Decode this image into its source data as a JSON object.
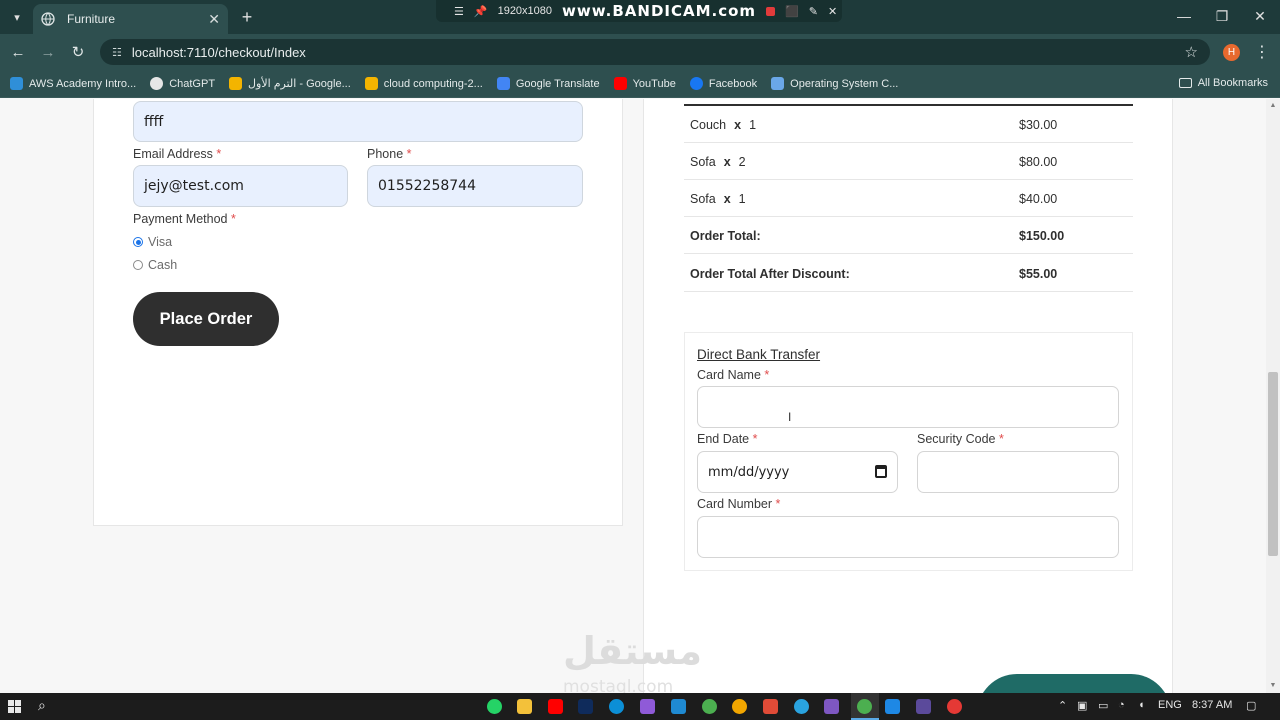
{
  "browser": {
    "tab_title": "Furniture",
    "url": "localhost:7110/checkout/Index",
    "recorder_resolution": "1920x1080",
    "recorder_brand": "www.BANDICAM.com",
    "bookmarks": [
      {
        "label": "AWS Academy Intro...",
        "color": "#2f8fd8"
      },
      {
        "label": "ChatGPT",
        "color": "#e6e6e6"
      },
      {
        "label": "الترم الأول - Google...",
        "color": "#f4b400"
      },
      {
        "label": "cloud computing-2...",
        "color": "#f4b400"
      },
      {
        "label": "Google Translate",
        "color": "#4285f4"
      },
      {
        "label": "YouTube",
        "color": "#ff0000"
      },
      {
        "label": "Facebook",
        "color": "#1877f2"
      },
      {
        "label": "Operating System C...",
        "color": "#6aa7e8"
      }
    ],
    "all_bookmarks": "All Bookmarks",
    "avatar_letter": "H"
  },
  "form": {
    "name_value": "ffff",
    "email_label": "Email Address",
    "email_value": "jejy@test.com",
    "phone_label": "Phone",
    "phone_value": "01552258744",
    "payment_label": "Payment Method",
    "required_mark": "*",
    "options": [
      "Visa",
      "Cash"
    ],
    "selected": "Visa",
    "place_order": "Place Order"
  },
  "order": {
    "rows": [
      {
        "item": "Couch",
        "x": "x",
        "qty": "1",
        "price": "$30.00"
      },
      {
        "item": "Sofa",
        "x": "x",
        "qty": "2",
        "price": "$80.00"
      },
      {
        "item": "Sofa",
        "x": "x",
        "qty": "1",
        "price": "$40.00"
      }
    ],
    "total_label": "Order Total:",
    "total_value": "$150.00",
    "discount_label": "Order Total After Discount:",
    "discount_value": "$55.00"
  },
  "bank": {
    "title": "Direct Bank Transfer",
    "card_name_label": "Card Name",
    "end_date_label": "End Date",
    "end_date_placeholder": "mm/dd/yyyy",
    "security_label": "Security Code",
    "card_number_label": "Card Number"
  },
  "watermark": {
    "arabic": "مستقل",
    "latin": "mostaql.com"
  },
  "taskbar": {
    "lang": "ENG",
    "time": "8:37 AM"
  }
}
